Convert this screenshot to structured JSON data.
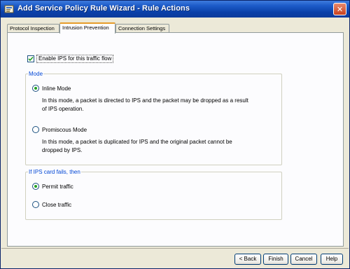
{
  "window": {
    "title": "Add Service Policy Rule Wizard - Rule Actions",
    "close_glyph": "✕"
  },
  "tabs": [
    {
      "label": "Protocol Inspection",
      "active": false
    },
    {
      "label": "Intrusion Prevention",
      "active": true
    },
    {
      "label": "Connection Settings",
      "active": false
    }
  ],
  "enable_ips": {
    "label": "Enable IPS for this traffic flow",
    "checked": true
  },
  "mode": {
    "legend": "Mode",
    "options": [
      {
        "label": "Inline Mode",
        "selected": true,
        "description_lines": [
          "In this mode, a packet is directed to IPS and the packet may be dropped as a result",
          "of IPS operation."
        ]
      },
      {
        "label": "Promiscous Mode",
        "selected": false,
        "description_lines": [
          "In this mode, a packet is duplicated for IPS and the original packet cannot be",
          "dropped by IPS."
        ]
      }
    ]
  },
  "failure": {
    "legend": "If IPS card fails, then",
    "options": [
      {
        "label": "Permit traffic",
        "selected": true
      },
      {
        "label": "Close traffic",
        "selected": false
      }
    ]
  },
  "buttons": {
    "back": "< Back",
    "finish": "Finish",
    "cancel": "Cancel",
    "help": "Help"
  },
  "colors": {
    "title_bar": "#0a3fa8",
    "legend_text": "#0046d5",
    "active_tab_accent": "#e69c2a",
    "radio_dot": "#21a121"
  },
  "icons": {
    "title": "wizard-app-icon",
    "close": "close-icon",
    "check": "checkmark-icon"
  }
}
